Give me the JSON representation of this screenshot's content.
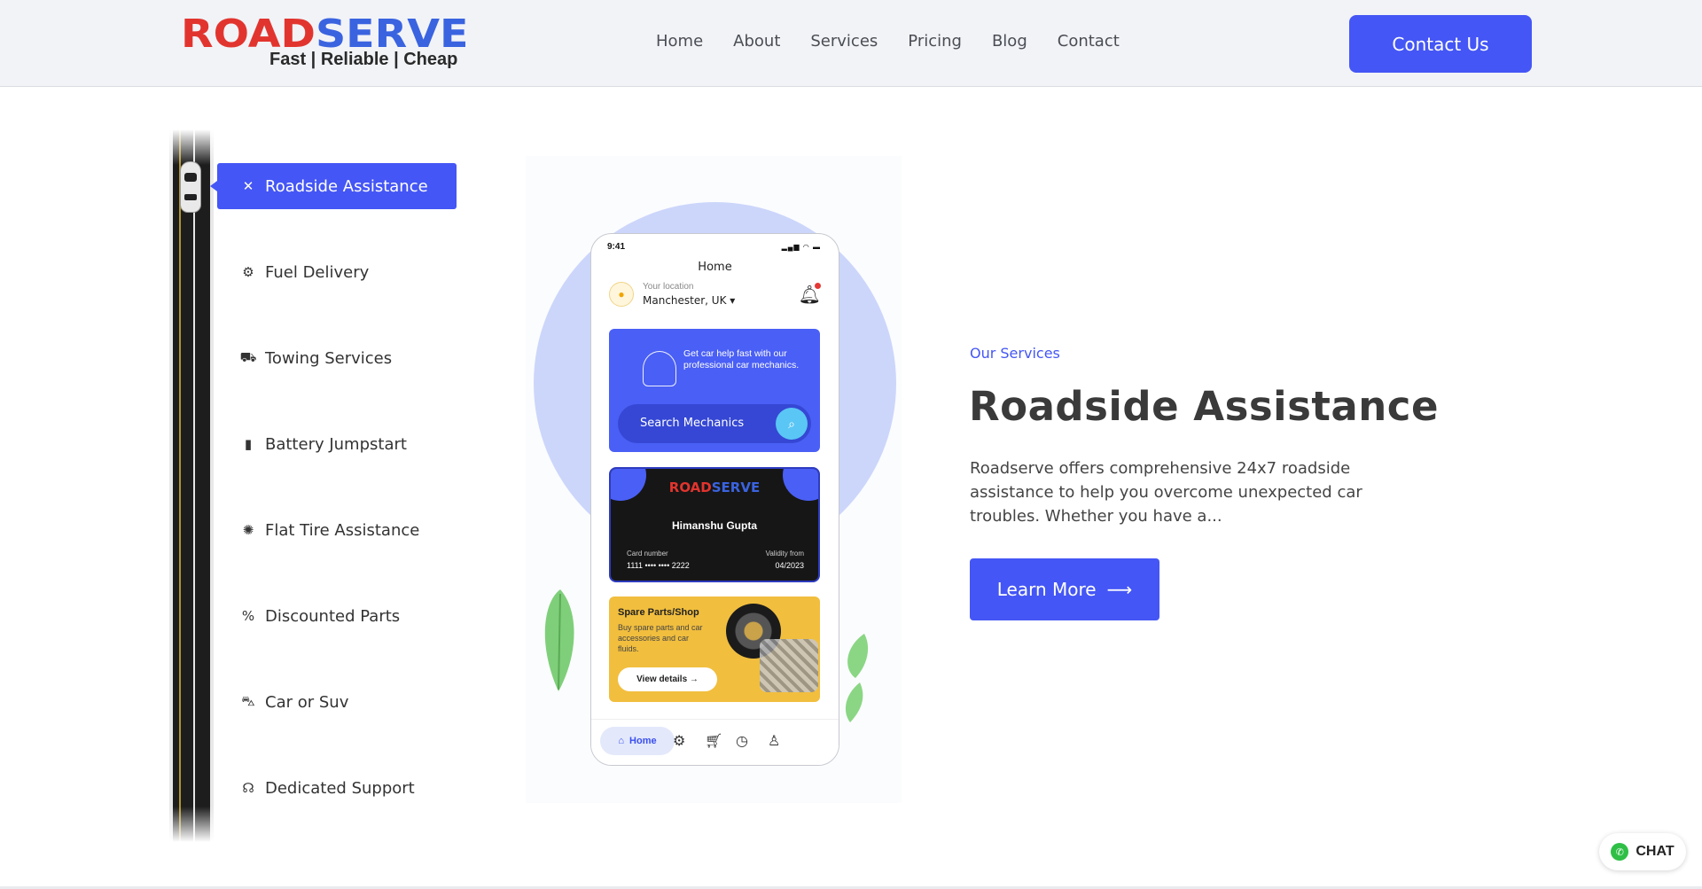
{
  "brand": {
    "logo_part1": "ROAD",
    "logo_part2": "SERVE",
    "tagline": "Fast | Reliable | Cheap",
    "colors": {
      "red": "#e2342e",
      "blue": "#3a63e0",
      "accent": "#4456f5"
    }
  },
  "nav": {
    "items": [
      "Home",
      "About",
      "Services",
      "Pricing",
      "Blog",
      "Contact"
    ],
    "cta": "Contact Us"
  },
  "services": {
    "active_index": 0,
    "items": [
      {
        "label": "Roadside Assistance",
        "icon": "wrench-screwdriver-icon"
      },
      {
        "label": "Fuel Delivery",
        "icon": "gear-icon"
      },
      {
        "label": "Towing Services",
        "icon": "tow-truck-icon"
      },
      {
        "label": "Battery Jumpstart",
        "icon": "battery-icon"
      },
      {
        "label": "Flat Tire Assistance",
        "icon": "tire-icon"
      },
      {
        "label": "Discounted Parts",
        "icon": "percent-badge-icon"
      },
      {
        "label": "Car or Suv",
        "icon": "car-icon"
      },
      {
        "label": "Dedicated Support",
        "icon": "headset-icon"
      }
    ]
  },
  "phone": {
    "time": "9:41",
    "title": "Home",
    "location_label": "Your location",
    "location": "Manchester, UK",
    "help_text": "Get car help fast with our professional car mechanics.",
    "search_label": "Search Mechanics",
    "card": {
      "logo_part1": "ROAD",
      "logo_part2": "SERVE",
      "name": "Himanshu Gupta",
      "number_label": "Card number",
      "number": "1111 •••• •••• 2222",
      "validity_label": "Validity from",
      "validity": "04/2023"
    },
    "shop": {
      "title": "Spare Parts/Shop",
      "desc": "Buy spare parts and car accessories and car fluids.",
      "button": "View details"
    },
    "tabbar": {
      "home": "Home"
    }
  },
  "content": {
    "eyebrow": "Our Services",
    "heading": "Roadside Assistance",
    "description": "Roadserve offers comprehensive 24x7 roadside assistance to help you overcome unexpected car troubles. Whether you have a...",
    "button": "Learn More"
  },
  "chat": {
    "label": "CHAT"
  }
}
